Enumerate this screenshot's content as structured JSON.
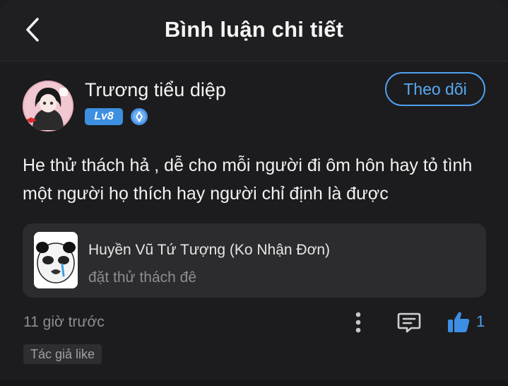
{
  "header": {
    "title": "Bình luận chi tiết",
    "back_icon": "chevron-left-icon"
  },
  "comment": {
    "author": {
      "name": "Trương tiểu diệp",
      "level": "Lv8",
      "vip_icon": "diamond-badge-icon"
    },
    "follow_label": "Theo dõi",
    "text": "He thử thách hả , dễ cho mỗi người đi ôm hôn hay tỏ tình một người họ thích hay người chỉ định là được",
    "quote": {
      "author": "Huyền Vũ Tứ Tượng (Ko Nhận Đơn)",
      "content": "đặt thử thách đê"
    },
    "timestamp": "11 giờ trước",
    "like_count": "1",
    "author_liked_label": "Tác giả like"
  },
  "colors": {
    "background": "#1c1c1e",
    "accent": "#4fa0ee",
    "card": "#2c2c2e",
    "muted_text": "#8e8e93"
  }
}
